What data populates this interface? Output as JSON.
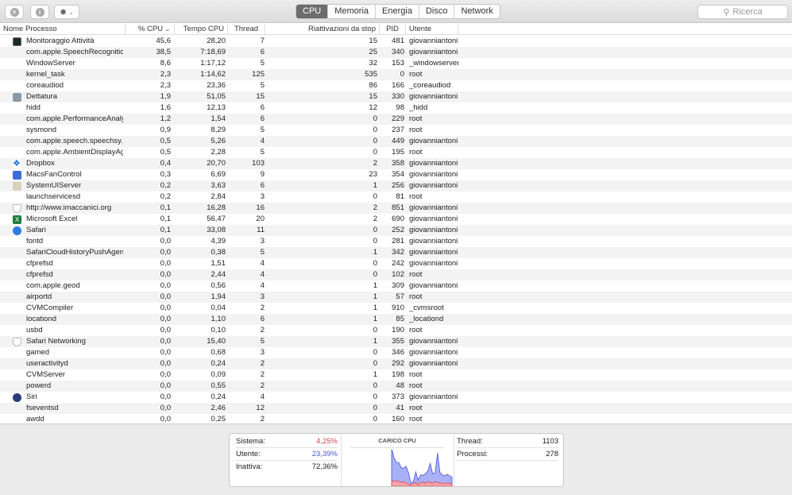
{
  "toolbar": {
    "close_icon": "x-circle-icon",
    "info_icon": "info-icon",
    "gear_icon": "gear-icon",
    "tabs": [
      "CPU",
      "Memoria",
      "Energia",
      "Disco",
      "Network"
    ],
    "active_tab": "CPU",
    "search_placeholder": "Ricerca"
  },
  "columns": [
    "Nome Processo",
    "% CPU",
    "Tempo CPU",
    "Thread",
    "Riattivazioni da stop",
    "PID",
    "Utente"
  ],
  "sort_indicator": "⌄",
  "rows": [
    [
      "Monitoraggio Attività",
      "45,6",
      "28,20",
      "7",
      "15",
      "481",
      "giovanniantoni",
      "activity-monitor"
    ],
    [
      "com.apple.SpeechRecognitio...",
      "38,5",
      "7:18,69",
      "6",
      "25",
      "340",
      "giovanniantoni",
      ""
    ],
    [
      "WindowServer",
      "8,6",
      "1:17,12",
      "5",
      "32",
      "153",
      "_windowserver",
      ""
    ],
    [
      "kernel_task",
      "2,3",
      "1:14,62",
      "125",
      "535",
      "0",
      "root",
      ""
    ],
    [
      "coreaudiod",
      "2,3",
      "23,36",
      "5",
      "86",
      "166",
      "_coreaudiod",
      ""
    ],
    [
      "Dettatura",
      "1,9",
      "51,05",
      "15",
      "15",
      "330",
      "giovanniantoni",
      "dictation"
    ],
    [
      "hidd",
      "1,6",
      "12,13",
      "6",
      "12",
      "98",
      "_hidd",
      ""
    ],
    [
      "com.apple.PerformanceAnaly...",
      "1,2",
      "1,54",
      "6",
      "0",
      "229",
      "root",
      ""
    ],
    [
      "sysmond",
      "0,9",
      "8,29",
      "5",
      "0",
      "237",
      "root",
      ""
    ],
    [
      "com.apple.speech.speechsy...",
      "0,5",
      "5,26",
      "4",
      "0",
      "449",
      "giovanniantoni",
      ""
    ],
    [
      "com.apple.AmbientDisplayAg...",
      "0,5",
      "2,28",
      "5",
      "0",
      "195",
      "root",
      ""
    ],
    [
      "Dropbox",
      "0,4",
      "20,70",
      "103",
      "2",
      "358",
      "giovanniantoni",
      "dropbox"
    ],
    [
      "MacsFanControl",
      "0,3",
      "6,69",
      "9",
      "23",
      "354",
      "giovanniantoni",
      "fan"
    ],
    [
      "SystemUIServer",
      "0,2",
      "3,63",
      "6",
      "1",
      "256",
      "giovanniantoni",
      "systemui"
    ],
    [
      "launchservicesd",
      "0,2",
      "2,84",
      "3",
      "0",
      "81",
      "root",
      ""
    ],
    [
      "http://www.imaccanici.org",
      "0,1",
      "16,28",
      "16",
      "2",
      "851",
      "giovanniantoni",
      "shield"
    ],
    [
      "Microsoft Excel",
      "0,1",
      "56,47",
      "20",
      "2",
      "690",
      "giovanniantoni",
      "excel"
    ],
    [
      "Safari",
      "0,1",
      "33,08",
      "11",
      "0",
      "252",
      "giovanniantoni",
      "safari"
    ],
    [
      "fontd",
      "0,0",
      "4,39",
      "3",
      "0",
      "281",
      "giovanniantoni",
      ""
    ],
    [
      "SafariCloudHistoryPushAgent",
      "0,0",
      "0,38",
      "5",
      "1",
      "342",
      "giovanniantoni",
      ""
    ],
    [
      "cfprefsd",
      "0,0",
      "1,51",
      "4",
      "0",
      "242",
      "giovanniantoni",
      ""
    ],
    [
      "cfprefsd",
      "0,0",
      "2,44",
      "4",
      "0",
      "102",
      "root",
      ""
    ],
    [
      "com.apple.geod",
      "0,0",
      "0,56",
      "4",
      "1",
      "309",
      "giovanniantoni",
      ""
    ],
    [
      "airportd",
      "0,0",
      "1,94",
      "3",
      "1",
      "57",
      "root",
      ""
    ],
    [
      "CVMCompiler",
      "0,0",
      "0,04",
      "2",
      "1",
      "910",
      "_cvmsroot",
      ""
    ],
    [
      "locationd",
      "0,0",
      "1,10",
      "6",
      "1",
      "85",
      "_locationd",
      ""
    ],
    [
      "usbd",
      "0,0",
      "0,10",
      "2",
      "0",
      "190",
      "root",
      ""
    ],
    [
      "Safari Networking",
      "0,0",
      "15,40",
      "5",
      "1",
      "355",
      "giovanniantoni",
      "shield"
    ],
    [
      "gamed",
      "0,0",
      "0,68",
      "3",
      "0",
      "346",
      "giovanniantoni",
      ""
    ],
    [
      "useractivityd",
      "0,0",
      "0,24",
      "2",
      "0",
      "292",
      "giovanniantoni",
      ""
    ],
    [
      "CVMServer",
      "0,0",
      "0,09",
      "2",
      "1",
      "198",
      "root",
      ""
    ],
    [
      "powerd",
      "0,0",
      "0,55",
      "2",
      "0",
      "48",
      "root",
      ""
    ],
    [
      "Siri",
      "0,0",
      "0,24",
      "4",
      "0",
      "373",
      "giovanniantoni",
      "siri"
    ],
    [
      "fseventsd",
      "0,0",
      "2,46",
      "12",
      "0",
      "41",
      "root",
      ""
    ],
    [
      "awdd",
      "0,0",
      "0,25",
      "2",
      "0",
      "160",
      "root",
      ""
    ]
  ],
  "summary": {
    "sistema_label": "Sistema:",
    "sistema_value": "4,25%",
    "utente_label": "Utente:",
    "utente_value": "23,39%",
    "inattiva_label": "Inattiva:",
    "inattiva_value": "72,36%",
    "chart_title": "CARICO CPU",
    "thread_label": "Thread:",
    "thread_value": "1103",
    "processi_label": "Processi:",
    "processi_value": "278",
    "colors": {
      "sistema": "#e0454f",
      "utente": "#4a55d8"
    }
  },
  "cpu_load_history": {
    "user_percent": [
      68,
      50,
      38,
      40,
      30,
      28,
      35,
      24,
      4,
      4,
      22,
      10,
      16,
      14,
      20,
      22,
      40,
      20,
      18,
      62,
      22,
      18,
      16,
      18,
      16,
      14
    ],
    "system_percent": [
      12,
      10,
      12,
      10,
      8,
      10,
      7,
      4,
      3,
      6,
      8,
      3,
      8,
      9,
      6,
      10,
      8,
      6,
      10,
      8,
      7,
      6,
      6,
      7,
      6,
      5
    ]
  }
}
